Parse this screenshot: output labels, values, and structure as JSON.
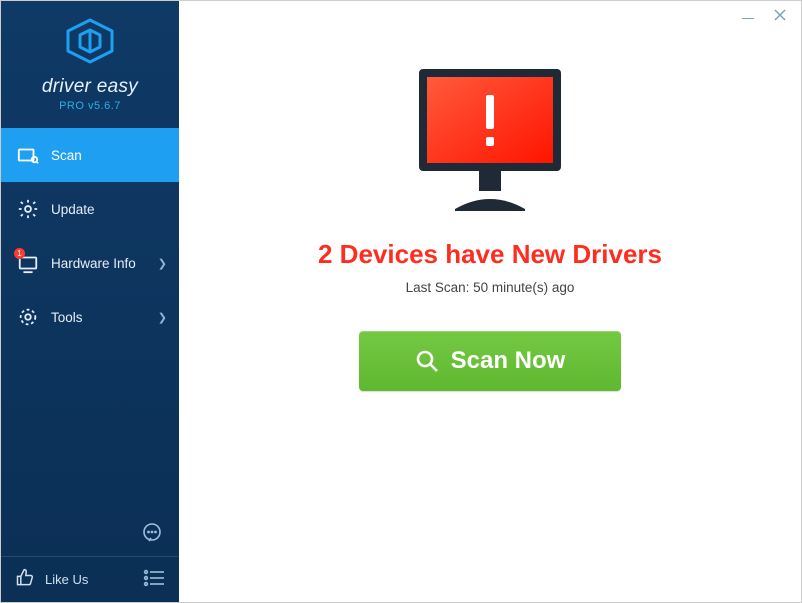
{
  "app": {
    "name": "driver easy",
    "version_label": "PRO v5.6.7"
  },
  "sidebar": {
    "items": [
      {
        "label": "Scan"
      },
      {
        "label": "Update"
      },
      {
        "label": "Hardware Info"
      },
      {
        "label": "Tools"
      }
    ],
    "hardware_badge": "1",
    "like_label": "Like Us"
  },
  "main": {
    "headline": "2 Devices have New Drivers",
    "last_scan": "Last Scan: 50 minute(s) ago",
    "scan_button": "Scan Now"
  }
}
